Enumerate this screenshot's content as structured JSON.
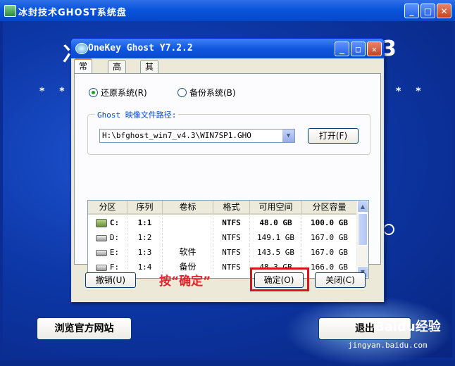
{
  "outer_window": {
    "title": "冰封技术GHOST系统盘",
    "deco_stars": "* *",
    "buttons": {
      "browse_site": "浏览官方网站",
      "exit": "退出"
    }
  },
  "dialog": {
    "title": "OneKey Ghost Y7.2.2",
    "tabs": [
      {
        "label": "常规"
      },
      {
        "label": "高级"
      },
      {
        "label": "其他"
      }
    ],
    "active_tab": "常规",
    "radios": {
      "restore": {
        "label": "还原系统(R)",
        "checked": true
      },
      "backup": {
        "label": "备份系统(B)",
        "checked": false
      }
    },
    "image_group": {
      "legend": "Ghost 映像文件路径:",
      "path_value": "H:\\bfghost_win7_v4.3\\WIN7SP1.GHO",
      "open_button": "打开(F)"
    },
    "partition_table": {
      "columns": [
        "分区",
        "序列",
        "卷标",
        "格式",
        "可用空间",
        "分区容量"
      ],
      "rows": [
        {
          "drive": "C:",
          "seq": "1:1",
          "label": "",
          "fs": "NTFS",
          "free": "48.0 GB",
          "size": "100.0 GB",
          "selected": true
        },
        {
          "drive": "D:",
          "seq": "1:2",
          "label": "",
          "fs": "NTFS",
          "free": "149.1 GB",
          "size": "167.0 GB",
          "selected": false
        },
        {
          "drive": "E:",
          "seq": "1:3",
          "label": "软件",
          "fs": "NTFS",
          "free": "143.5 GB",
          "size": "167.0 GB",
          "selected": false
        },
        {
          "drive": "F:",
          "seq": "1:4",
          "label": "备份",
          "fs": "NTFS",
          "free": "48.3 GB",
          "size": "166.0 GB",
          "selected": false
        }
      ]
    },
    "buttons": {
      "cancel": "撤销(U)",
      "ok": "确定(O)",
      "close": "关闭(C)"
    },
    "hint": "按“确定”"
  },
  "watermark": {
    "logo": "Baidu经验",
    "url": "jingyan.baidu.com"
  },
  "colors": {
    "titlebar": "#0a55dc",
    "dialog_bg": "#ece9d8",
    "hint_red": "#e8202a",
    "highlight": "#d8141c"
  }
}
